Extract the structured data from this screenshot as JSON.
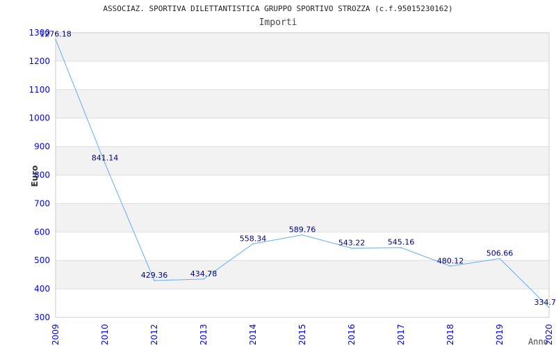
{
  "chart_data": {
    "type": "line",
    "title": "ASSOCIAZ. SPORTIVA DILETTANTISTICA GRUPPO SPORTIVO STROZZA (c.f.95015230162)",
    "subtitle": "Importi",
    "xlabel": "Anno",
    "ylabel": "Euro",
    "categories": [
      "2009",
      "2010",
      "2012",
      "2013",
      "2014",
      "2015",
      "2016",
      "2017",
      "2018",
      "2019",
      "2020"
    ],
    "values": [
      1276.18,
      841.14,
      429.36,
      434.78,
      558.34,
      589.76,
      543.22,
      545.16,
      480.12,
      506.66,
      334.7
    ],
    "data_labels": [
      "1276.18",
      "841.14",
      "429.36",
      "434.78",
      "558.34",
      "589.76",
      "543.22",
      "545.16",
      "480.12",
      "506.66",
      "334.7"
    ],
    "ylim": [
      300,
      1300
    ],
    "yticks": [
      "300",
      "400",
      "500",
      "600",
      "700",
      "800",
      "900",
      "1000",
      "1100",
      "1200",
      "1300"
    ],
    "grid": true,
    "colors": {
      "line": "#66aaff",
      "tick_labels": "#0000ff",
      "data_labels": "#000080",
      "band": "#f2f2f2"
    }
  }
}
